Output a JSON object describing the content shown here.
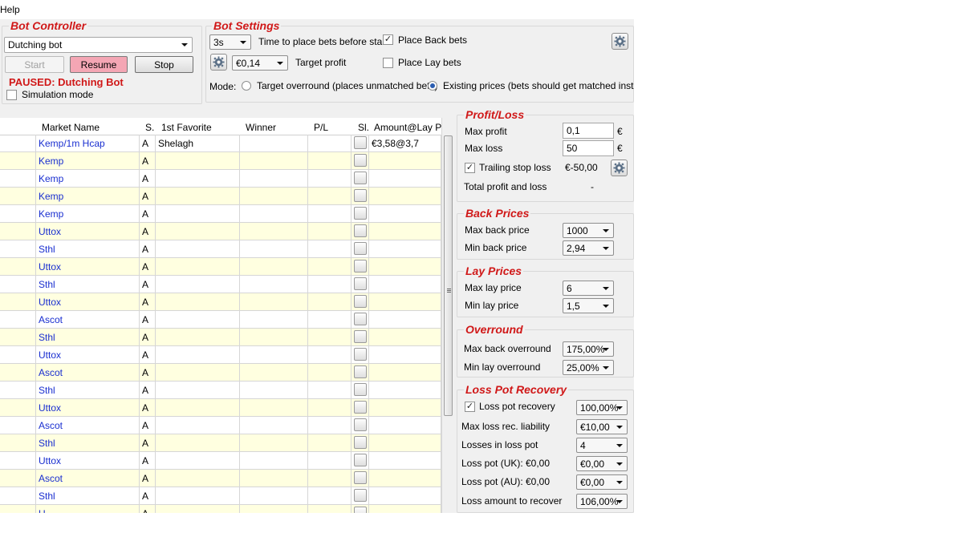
{
  "menu": {
    "help": "Help"
  },
  "bot_controller": {
    "title": "Bot Controller",
    "bot_select": "Dutching bot",
    "start": "Start",
    "resume": "Resume",
    "stop": "Stop",
    "status": "PAUSED: Dutching Bot",
    "simulation_mode": "Simulation mode",
    "simulation_checked": false
  },
  "bot_settings": {
    "title": "Bot Settings",
    "time_value": "3s",
    "time_label": "Time to place bets before start",
    "target_value": "€0,14",
    "target_label": "Target profit",
    "place_back_label": "Place Back bets",
    "place_back_checked": true,
    "place_lay_label": "Place Lay bets",
    "place_lay_checked": false,
    "mode_label": "Mode:",
    "mode_target": "Target overround (places unmatched bets)",
    "mode_existing": "Existing prices (bets should get matched instantly)",
    "selected_mode": "existing"
  },
  "grid": {
    "columns": [
      "Market Name",
      "S.",
      "1st Favorite",
      "Winner",
      "P/L",
      "Sl.",
      "Amount@Lay Pr."
    ],
    "rows": [
      {
        "market": "Kemp/1m Hcap",
        "s": "A",
        "fav": "Shelagh",
        "winner": "",
        "pl": "",
        "amount": "€3,58@3,7"
      },
      {
        "market": "Kemp",
        "s": "A",
        "fav": "",
        "winner": "",
        "pl": "",
        "amount": ""
      },
      {
        "market": "Kemp",
        "s": "A",
        "fav": "",
        "winner": "",
        "pl": "",
        "amount": ""
      },
      {
        "market": "Kemp",
        "s": "A",
        "fav": "",
        "winner": "",
        "pl": "",
        "amount": ""
      },
      {
        "market": "Kemp",
        "s": "A",
        "fav": "",
        "winner": "",
        "pl": "",
        "amount": ""
      },
      {
        "market": "Uttox",
        "s": "A",
        "fav": "",
        "winner": "",
        "pl": "",
        "amount": ""
      },
      {
        "market": "Sthl",
        "s": "A",
        "fav": "",
        "winner": "",
        "pl": "",
        "amount": ""
      },
      {
        "market": "Uttox",
        "s": "A",
        "fav": "",
        "winner": "",
        "pl": "",
        "amount": ""
      },
      {
        "market": "Sthl",
        "s": "A",
        "fav": "",
        "winner": "",
        "pl": "",
        "amount": ""
      },
      {
        "market": "Uttox",
        "s": "A",
        "fav": "",
        "winner": "",
        "pl": "",
        "amount": ""
      },
      {
        "market": "Ascot",
        "s": "A",
        "fav": "",
        "winner": "",
        "pl": "",
        "amount": ""
      },
      {
        "market": "Sthl",
        "s": "A",
        "fav": "",
        "winner": "",
        "pl": "",
        "amount": ""
      },
      {
        "market": "Uttox",
        "s": "A",
        "fav": "",
        "winner": "",
        "pl": "",
        "amount": ""
      },
      {
        "market": "Ascot",
        "s": "A",
        "fav": "",
        "winner": "",
        "pl": "",
        "amount": ""
      },
      {
        "market": "Sthl",
        "s": "A",
        "fav": "",
        "winner": "",
        "pl": "",
        "amount": ""
      },
      {
        "market": "Uttox",
        "s": "A",
        "fav": "",
        "winner": "",
        "pl": "",
        "amount": ""
      },
      {
        "market": "Ascot",
        "s": "A",
        "fav": "",
        "winner": "",
        "pl": "",
        "amount": ""
      },
      {
        "market": "Sthl",
        "s": "A",
        "fav": "",
        "winner": "",
        "pl": "",
        "amount": ""
      },
      {
        "market": "Uttox",
        "s": "A",
        "fav": "",
        "winner": "",
        "pl": "",
        "amount": ""
      },
      {
        "market": "Ascot",
        "s": "A",
        "fav": "",
        "winner": "",
        "pl": "",
        "amount": ""
      },
      {
        "market": "Sthl",
        "s": "A",
        "fav": "",
        "winner": "",
        "pl": "",
        "amount": ""
      },
      {
        "market": "U",
        "s": "A",
        "fav": "",
        "winner": "",
        "pl": "",
        "amount": ""
      }
    ]
  },
  "profit_loss": {
    "title": "Profit/Loss",
    "max_profit_label": "Max profit",
    "max_profit_value": "0,1",
    "max_loss_label": "Max loss",
    "max_loss_value": "50",
    "currency": "€",
    "trailing_label": "Trailing stop loss",
    "trailing_checked": true,
    "trailing_value": "€-50,00",
    "total_label": "Total profit and loss",
    "total_value": "-"
  },
  "back_prices": {
    "title": "Back Prices",
    "max_label": "Max back price",
    "max_value": "1000",
    "min_label": "Min back price",
    "min_value": "2,94"
  },
  "lay_prices": {
    "title": "Lay Prices",
    "max_label": "Max lay price",
    "max_value": "6",
    "min_label": "Min lay price",
    "min_value": "1,5"
  },
  "overround": {
    "title": "Overround",
    "max_back_label": "Max back overround",
    "max_back_value": "175,00%",
    "min_lay_label": "Min lay overround",
    "min_lay_value": "25,00%"
  },
  "loss_pot": {
    "title": "Loss Pot Recovery",
    "recovery_label": "Loss pot recovery",
    "recovery_checked": true,
    "recovery_value": "100,00%",
    "max_liability_label": "Max loss rec. liability",
    "max_liability_value": "€10,00",
    "losses_label": "Losses in loss pot",
    "losses_value": "4",
    "uk_label": "Loss pot (UK):",
    "uk_amount": "€0,00",
    "uk_value": "€0,00",
    "au_label": "Loss pot (AU):",
    "au_amount": "€0,00",
    "au_value": "€0,00",
    "recover_label": "Loss amount to recover",
    "recover_value": "106,00%"
  }
}
